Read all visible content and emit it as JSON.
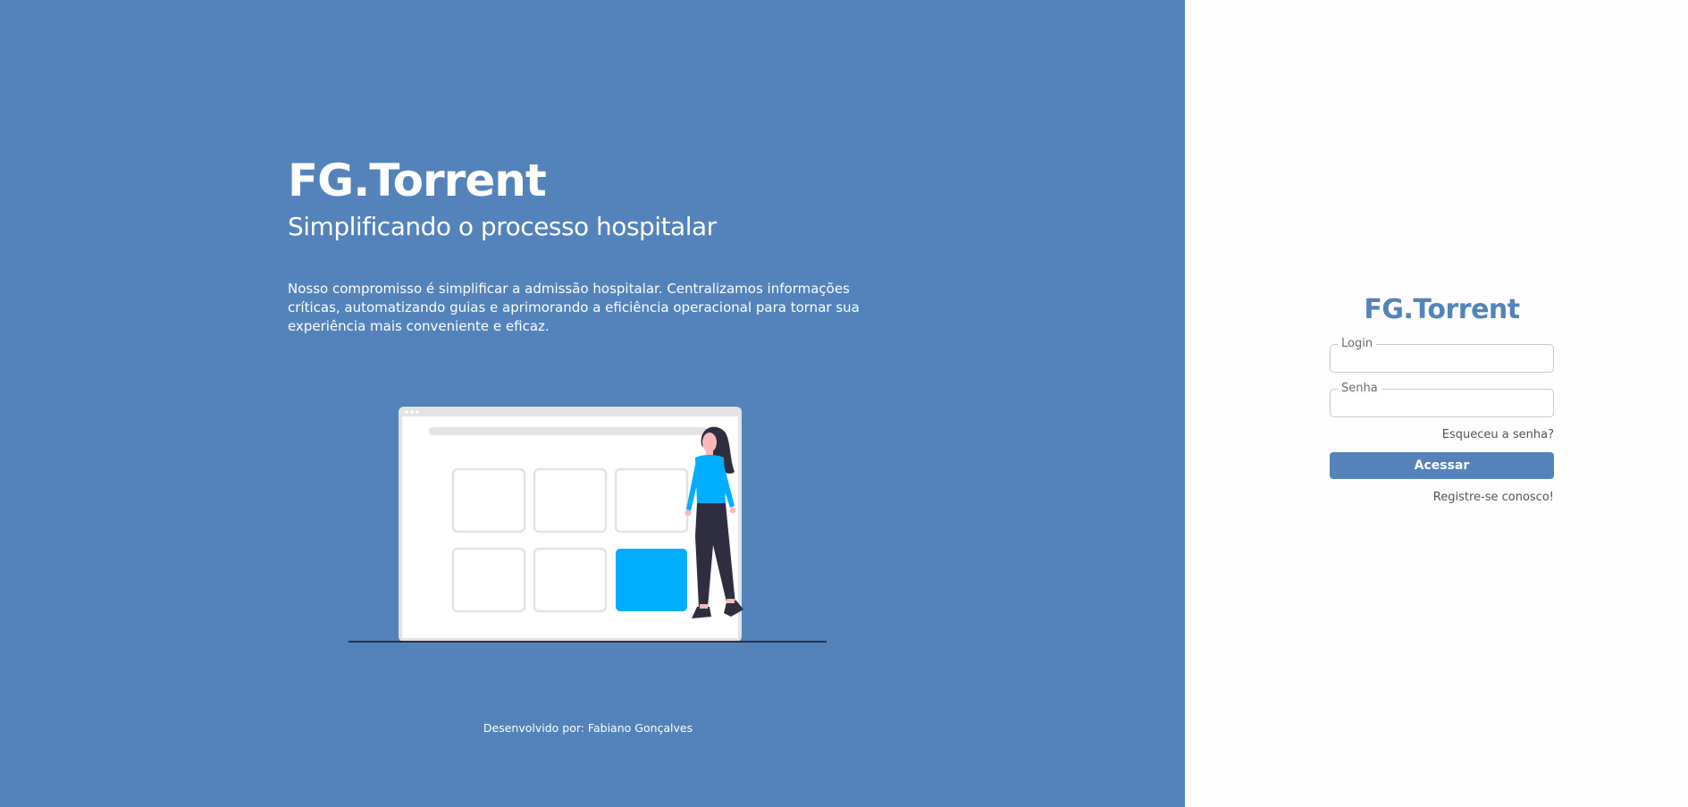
{
  "hero": {
    "title": "FG.Torrent",
    "subtitle": "Simplificando o processo hospitalar",
    "description": "Nosso compromisso é simplificar a admissão hospitalar. Centralizamos informações críticas, automatizando guias e aprimorando a eficiência operacional para tornar sua experiência mais conveniente e eficaz.",
    "footer": "Desenvolvido por: Fabiano Gonçalves",
    "illustration": {
      "icon": "person-with-dashboard-illustration",
      "accent_color": "#00adff",
      "tile_count": 6,
      "highlighted_tile": 6
    }
  },
  "login": {
    "title": "FG.Torrent",
    "login_label": "Login",
    "login_value": "",
    "senha_label": "Senha",
    "senha_value": "",
    "forgot_label": "Esqueceu a senha?",
    "submit_label": "Acessar",
    "register_label": "Registre-se conosco!"
  },
  "colors": {
    "brand": "#5383ba",
    "panel_background": "#fdfdfd",
    "accent": "#00adff"
  }
}
